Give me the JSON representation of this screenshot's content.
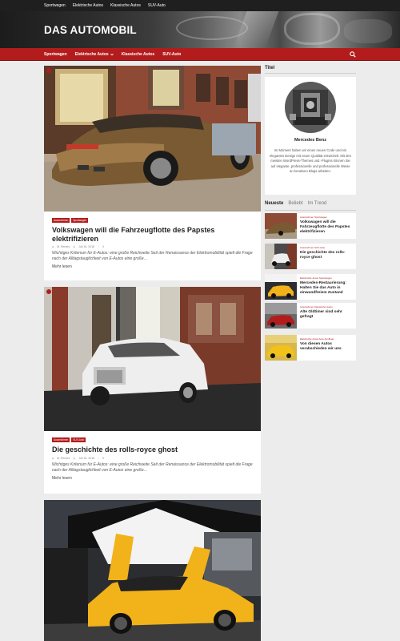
{
  "topbar": {
    "links": [
      "Sportwagen",
      "Elektrische Autos",
      "Klassische Autos",
      "SUV-Auto"
    ]
  },
  "site": {
    "title": "DAS AUTOMOBIL"
  },
  "nav": {
    "items": [
      "Sportwagen",
      "Elektrische Autos",
      "Klassische Autos",
      "SUV-Auto"
    ]
  },
  "posts": [
    {
      "cats": [
        "Auszeichnen",
        "Sportwagen"
      ],
      "title": "Volkswagen will die Fahrzeugflotte des Papstes elektrifizieren",
      "author": "M. Remes",
      "date": "Juli 16, 2018",
      "comments": "0",
      "excerpt": "Wichtiges Kriterium für E-Autos: eine große Reichweite Seit der Renaissance der Elektromobilität spielt die Frage nach der Alltagstauglichkeit von E-Autos eine große…",
      "readmore": "Mehr lesen"
    },
    {
      "cats": [
        "Auszeichnen",
        "SUV-Auto"
      ],
      "title": "Die geschichte des rolls-royce ghost",
      "author": "M. Remes",
      "date": "Juli 16, 2018",
      "comments": "0",
      "excerpt": "Wichtiges Kriterium für E-Autos: eine große Reichweite Seit der Renaissance der Elektromobilität spielt die Frage nach der Alltagstauglichkeit von E-Autos eine große…",
      "readmore": "Mehr lesen"
    }
  ],
  "sidebar": {
    "heading": "Titel",
    "author": {
      "name": "Mercedes Benz",
      "description": "Im Moment haben wir einen neuen Code und ein elegantes Design mit neuer Qualität entwickelt. Mit den meisten WordPress-Themes und -Plugins können Sie auf elegante, professionelle und professionelle Weise an kreativen Blogs arbeiten."
    },
    "tabs": [
      "Neueste",
      "Beliebt",
      "Im Trend"
    ],
    "items": [
      {
        "cats": "Auszeichnen  Sportwagen",
        "title": "Volkswagen will die Fahrzeugflotte des Papstes elektrifizieren"
      },
      {
        "cats": "Auszeichnen  SUV-Auto",
        "title": "Die geschichte des rolls-royce ghost"
      },
      {
        "cats": "Elektrische Autos  Sportwagen",
        "title": "Mercedes-Restaurierung: Halten Sie das Auto in einwandfreiem Zustand"
      },
      {
        "cats": "Auszeichnen  Klassische Autos",
        "title": "Alte Oldtimer sind sehr gefragt"
      },
      {
        "cats": "Elektrische Autos  Auto Ausflüge",
        "title": "Von diesen Autos verabschieden wir uns"
      }
    ]
  }
}
